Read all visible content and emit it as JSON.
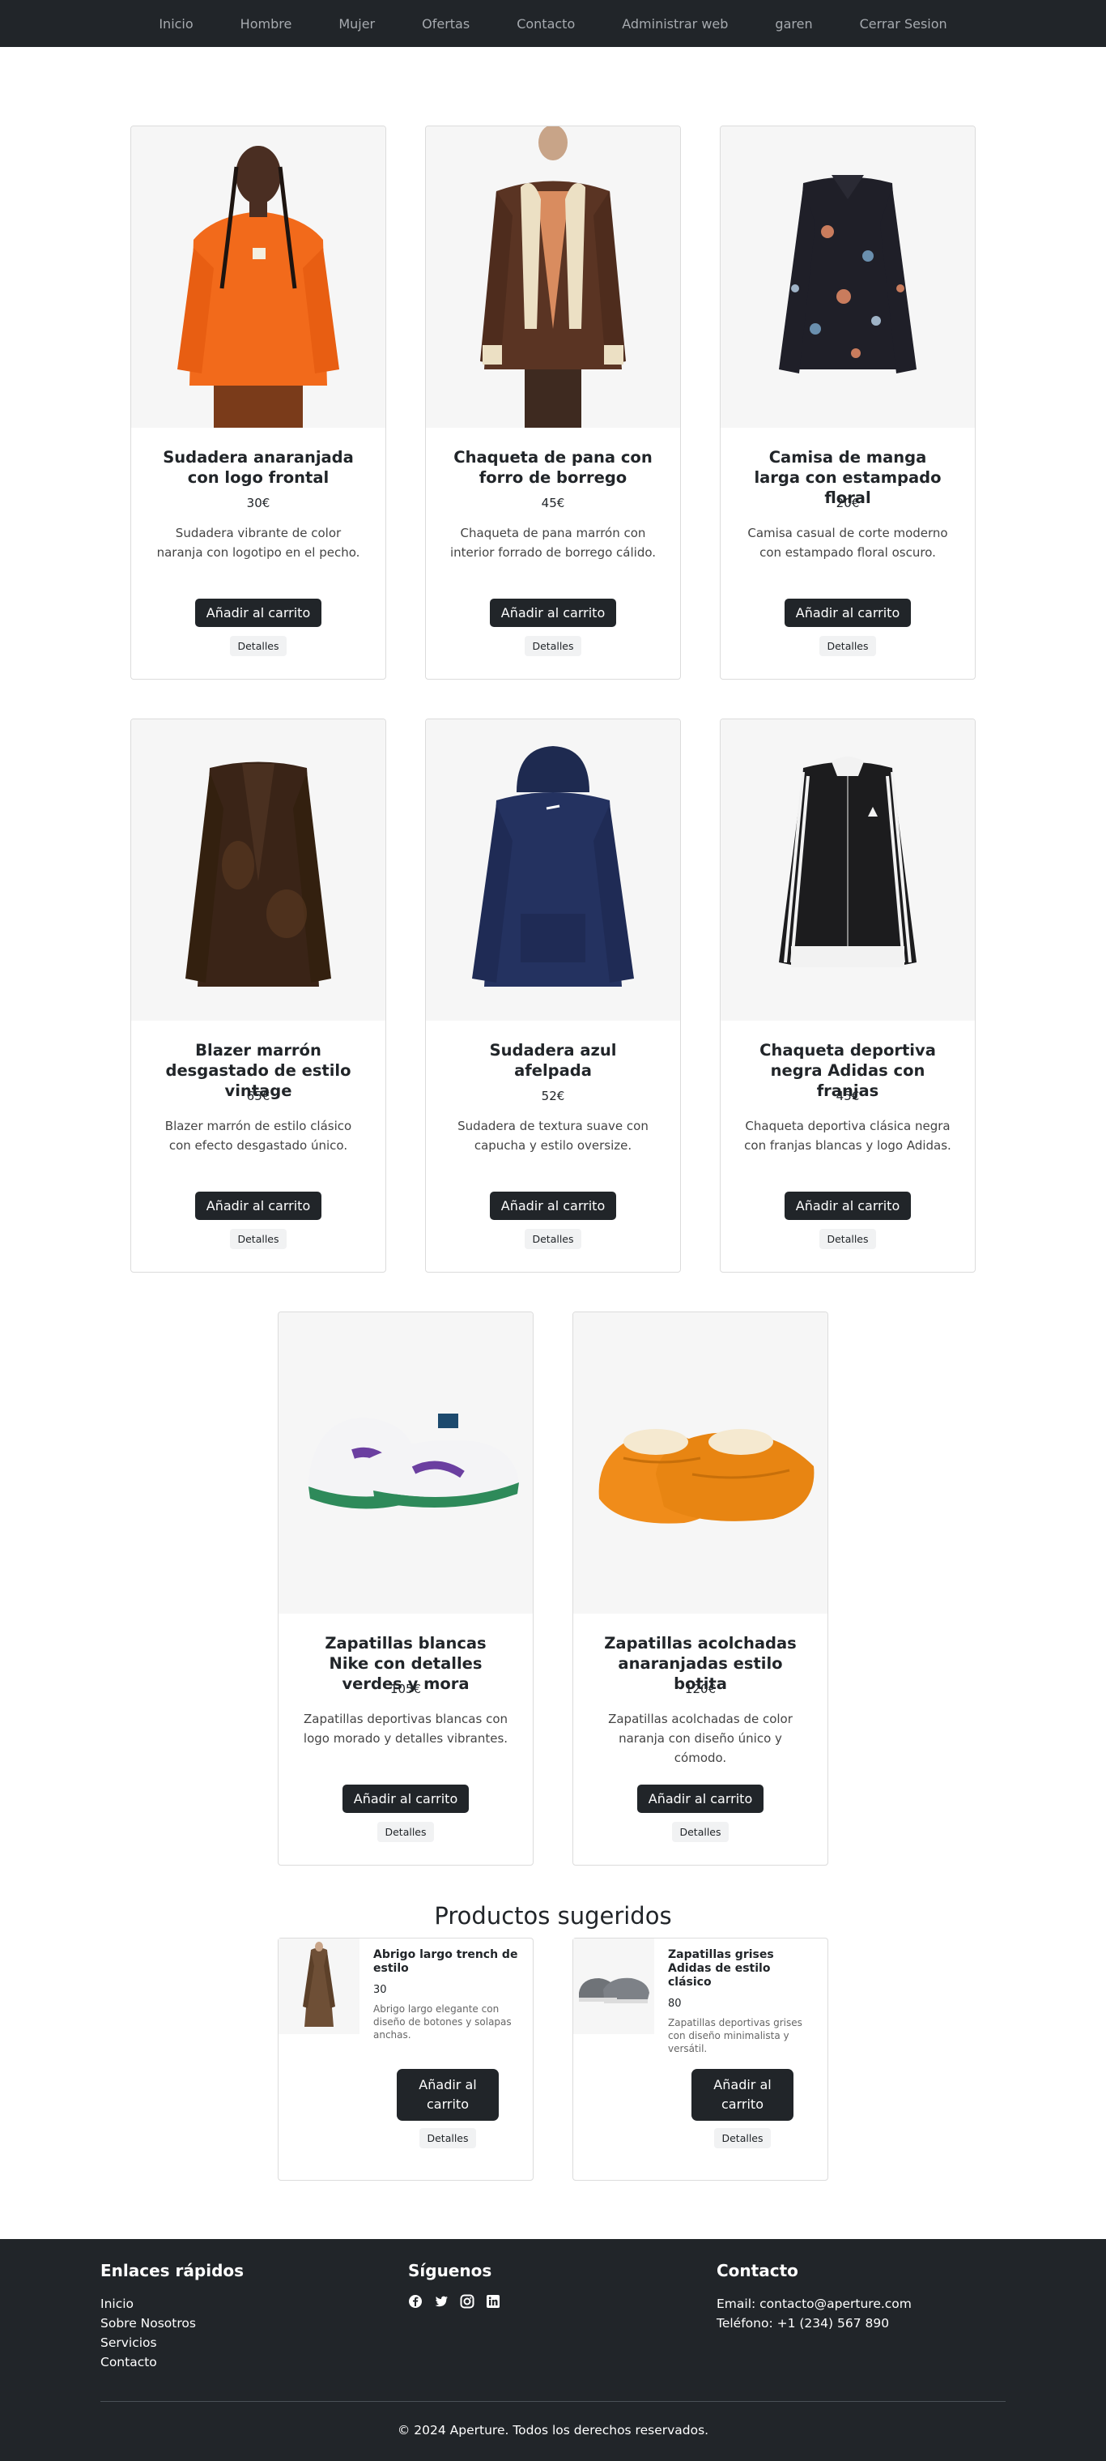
{
  "nav": {
    "items": [
      "Inicio",
      "Hombre",
      "Mujer",
      "Ofertas",
      "Contacto",
      "Administrar web",
      "garen",
      "Cerrar Sesion"
    ]
  },
  "products": [
    {
      "title": "Sudadera anaranjada con logo frontal",
      "price": "30€",
      "desc": "Sudadera vibrante de color naranja con logotipo en el pecho.",
      "add": "Añadir al carrito",
      "details": "Detalles"
    },
    {
      "title": "Chaqueta de pana con forro de borrego",
      "price": "45€",
      "desc": "Chaqueta de pana marrón con interior forrado de borrego cálido.",
      "add": "Añadir al carrito",
      "details": "Detalles"
    },
    {
      "title": "Camisa de manga larga con estampado floral",
      "price": "20€",
      "desc": "Camisa casual de corte moderno con estampado floral oscuro.",
      "add": "Añadir al carrito",
      "details": "Detalles"
    },
    {
      "title": "Blazer marrón desgastado de estilo vintage",
      "price": "65€",
      "desc": "Blazer marrón de estilo clásico con efecto desgastado único.",
      "add": "Añadir al carrito",
      "details": "Detalles"
    },
    {
      "title": "Sudadera azul afelpada",
      "price": "52€",
      "desc": "Sudadera de textura suave con capucha y estilo oversize.",
      "add": "Añadir al carrito",
      "details": "Detalles"
    },
    {
      "title": "Chaqueta deportiva negra Adidas con franjas",
      "price": "45€",
      "desc": "Chaqueta deportiva clásica negra con franjas blancas y logo Adidas.",
      "add": "Añadir al carrito",
      "details": "Detalles"
    },
    {
      "title": "Zapatillas blancas Nike con detalles verdes y mora",
      "price": "105€",
      "desc": "Zapatillas deportivas blancas con logo morado y detalles vibrantes.",
      "add": "Añadir al carrito",
      "details": "Detalles"
    },
    {
      "title": "Zapatillas acolchadas anaranjadas estilo botita",
      "price": "120€",
      "desc": "Zapatillas acolchadas de color naranja con diseño único y cómodo.",
      "add": "Añadir al carrito",
      "details": "Detalles"
    }
  ],
  "suggested": {
    "heading": "Productos sugeridos",
    "items": [
      {
        "title": "Abrigo largo trench de estilo",
        "price": "30",
        "desc": "Abrigo largo elegante con diseño de botones y solapas anchas.",
        "add": "Añadir al carrito",
        "details": "Detalles"
      },
      {
        "title": "Zapatillas grises Adidas de estilo clásico",
        "price": "80",
        "desc": "Zapatillas deportivas grises con diseño minimalista y versátil.",
        "add": "Añadir al carrito",
        "details": "Detalles"
      }
    ]
  },
  "footer": {
    "quick_links_title": "Enlaces rápidos",
    "quick_links": [
      "Inicio",
      "Sobre Nosotros",
      "Servicios",
      "Contacto"
    ],
    "follow_title": "Síguenos",
    "social_icons": [
      "facebook-icon",
      "twitter-icon",
      "instagram-icon",
      "linkedin-icon"
    ],
    "contact_title": "Contacto",
    "email": "Email: contacto@aperture.com",
    "phone": "Teléfono: +1 (234) 567 890",
    "copyright": "© 2024 Aperture. Todos los derechos reservados."
  },
  "colors": {
    "navbar_bg": "#212529",
    "footer_bg": "#212529",
    "button_dark": "#212529",
    "card_image_bg": "#f6f6f6"
  }
}
